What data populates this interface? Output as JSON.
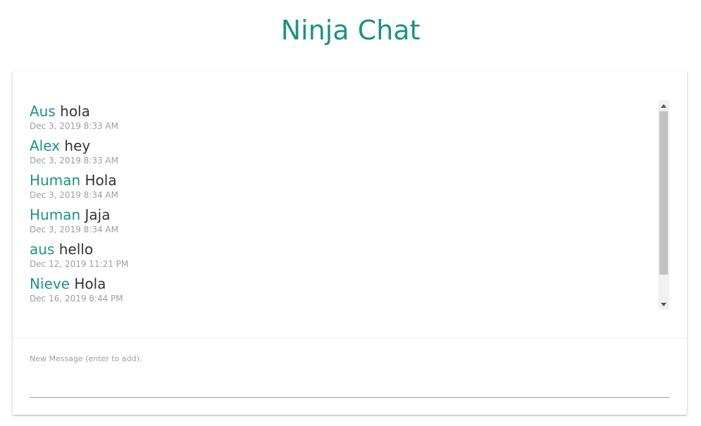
{
  "app": {
    "title": "Ninja Chat"
  },
  "messages": [
    {
      "name": "Aus",
      "text": "hola",
      "time": "Dec 3, 2019 8:33 AM"
    },
    {
      "name": "Alex",
      "text": "hey",
      "time": "Dec 3, 2019 8:33 AM"
    },
    {
      "name": "Human",
      "text": "Hola",
      "time": "Dec 3, 2019 8:34 AM"
    },
    {
      "name": "Human",
      "text": "Jaja",
      "time": "Dec 3, 2019 8:34 AM"
    },
    {
      "name": "aus",
      "text": "hello",
      "time": "Dec 12, 2019 11:21 PM"
    },
    {
      "name": "Nieve",
      "text": "Hola",
      "time": "Dec 16, 2019 8:44 PM"
    }
  ],
  "new_message": {
    "label": "New Message (enter to add):",
    "value": ""
  },
  "icons": {
    "scroll_up": "arrow-up-icon",
    "scroll_down": "arrow-down-icon"
  },
  "colors": {
    "accent": "#1b9385",
    "message_text": "#333333",
    "timestamp": "#9e9e9e"
  }
}
